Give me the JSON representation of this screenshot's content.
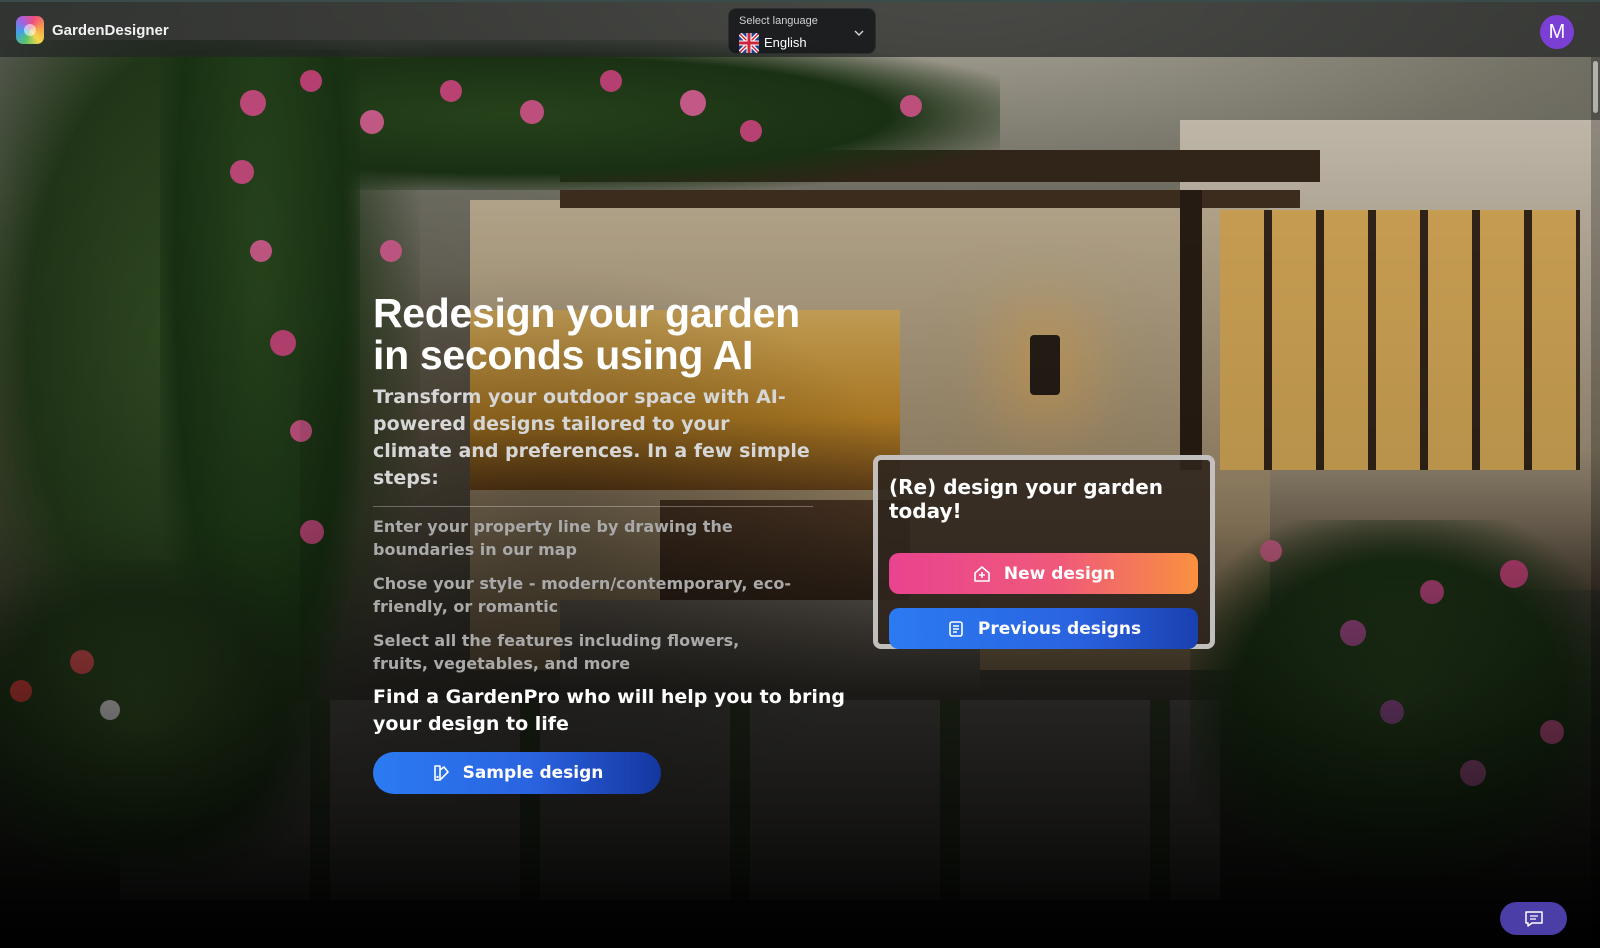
{
  "app": {
    "name": "GardenDesigner",
    "logo_icon": "garden-logo-icon"
  },
  "language": {
    "label": "Select language",
    "value": "English",
    "flag_icon": "uk-flag-icon"
  },
  "user": {
    "avatar_initial": "M",
    "avatar_color": "#7c3fd6"
  },
  "hero": {
    "title_line1": "Redesign your garden",
    "title_line2": "in seconds using AI",
    "subtitle": "Transform your outdoor space with AI-powered designs tailored to your climate and preferences. In a few simple steps:",
    "steps": [
      "Enter your property line by drawing the boundaries in our map",
      "Chose your style - modern/contemporary, eco-friendly, or romantic",
      "Select all the features including flowers, fruits, vegetables, and more"
    ],
    "pro_text": "Find a GardenPro who will help you to bring your design to life",
    "sample_button": "Sample design"
  },
  "card": {
    "title": "(Re) design your garden today!",
    "new_button": "New design",
    "previous_button": "Previous designs"
  },
  "colors": {
    "accent_pink": "#e9438f",
    "accent_orange": "#f8913f",
    "accent_blue": "#2b7bf2",
    "chat_purple": "#4b3ea6"
  }
}
